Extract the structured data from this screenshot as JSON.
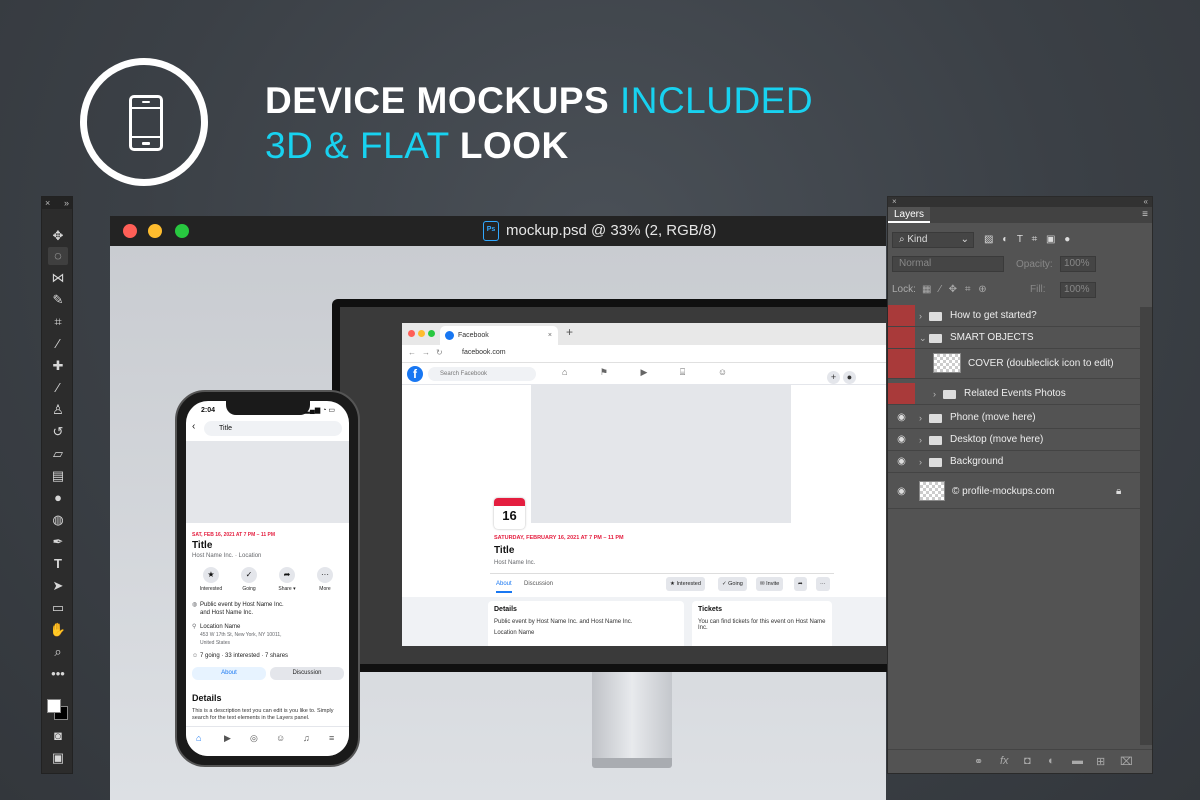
{
  "header": {
    "line1_bold": "DEVICE MOCKUPS",
    "line1_light": "INCLUDED",
    "line2_light": "3D & FLAT",
    "line2_bold": "LOOK",
    "icon": "smartphone-icon"
  },
  "canvas": {
    "app_badge": "Ps",
    "title": "mockup.psd @ 33% (2, RGB/8)"
  },
  "browser": {
    "tab_title": "Facebook",
    "url": "facebook.com",
    "search_placeholder": "Search Facebook",
    "cal_day": "16",
    "event_date": "SATURDAY, FEBRUARY 16, 2021 AT 7 PM – 11 PM",
    "event_title": "Title",
    "host": "Host Name Inc.",
    "tab_about": "About",
    "tab_discussion": "Discussion",
    "btn_interested": "★ Interested",
    "btn_going": "✓ Going",
    "btn_invite": "✉ Invite",
    "details_heading": "Details",
    "details_line1": "Public event by Host Name Inc. and Host Name Inc.",
    "details_line2": "Location Name",
    "tickets_heading": "Tickets",
    "tickets_text": "You can find tickets for this event on Host Name Inc."
  },
  "phone": {
    "time": "2:04",
    "search_value": "Title",
    "event_date": "SAT, FEB 16, 2021 AT 7 PM – 11 PM",
    "event_title": "Title",
    "host": "Host Name Inc. · Location",
    "actions": [
      "Interested",
      "Going",
      "Share ▾",
      "More"
    ],
    "info_public_1": "Public event by Host Name Inc.",
    "info_public_2": "and Host Name Inc.",
    "location_name": "Location Name",
    "address_1": "453 W 17th St, New York, NY 10011,",
    "address_2": "United States",
    "stats": "7 going · 33 interested · 7 shares",
    "tab_about": "About",
    "tab_discussion": "Discussion",
    "details_heading": "Details",
    "description": "This is a description text you can edit is you like to. Simply search for the text elements in the Layers panel."
  },
  "layers_panel": {
    "tab": "Layers",
    "filter_kind": "Kind",
    "blend_mode": "Normal",
    "opacity_label": "Opacity:",
    "opacity_value": "100%",
    "lock_label": "Lock:",
    "fill_label": "Fill:",
    "fill_value": "100%",
    "layers": [
      {
        "name": "How to get started?",
        "visible": false,
        "type": "group"
      },
      {
        "name": "SMART OBJECTS",
        "visible": false,
        "type": "group",
        "expanded": true
      },
      {
        "name": "COVER (doubleclick icon to edit)",
        "visible": false,
        "type": "smart-object"
      },
      {
        "name": "Related Events Photos",
        "visible": false,
        "type": "group"
      },
      {
        "name": "Phone (move here)",
        "visible": true,
        "type": "group"
      },
      {
        "name": "Desktop (move here)",
        "visible": true,
        "type": "group"
      },
      {
        "name": "Background",
        "visible": true,
        "type": "group"
      },
      {
        "name": "© profile-mockups.com",
        "visible": true,
        "type": "layer",
        "locked": true
      }
    ]
  },
  "colors": {
    "accent_cyan": "#18d2f0",
    "fb_blue": "#1877f2",
    "fb_red": "#e41e3f",
    "hidden_layer_red": "#a93a3a"
  }
}
